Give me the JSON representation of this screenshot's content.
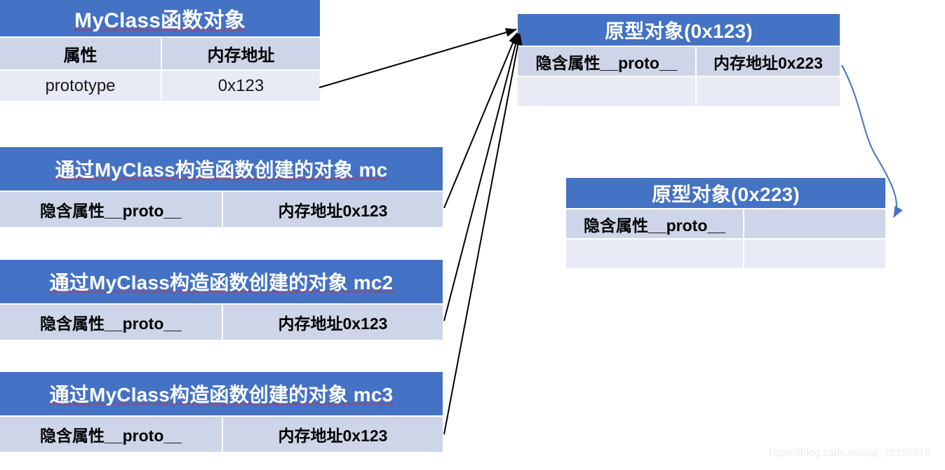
{
  "tables": {
    "myclass": {
      "title": "MyClass函数对象",
      "columns": [
        "属性",
        "内存地址"
      ],
      "rows": [
        [
          "prototype",
          "0x123"
        ]
      ]
    },
    "mc": {
      "title": "通过MyClass构造函数创建的对象 mc",
      "rows": [
        [
          "隐含属性__proto__",
          "内存地址0x123"
        ]
      ]
    },
    "mc2": {
      "title": "通过MyClass构造函数创建的对象 mc2",
      "rows": [
        [
          "隐含属性__proto__",
          "内存地址0x123"
        ]
      ]
    },
    "mc3": {
      "title": "通过MyClass构造函数创建的对象 mc3",
      "rows": [
        [
          "隐含属性__proto__",
          "内存地址0x123"
        ]
      ]
    },
    "proto1": {
      "title": "原型对象(0x123)",
      "rows": [
        [
          "隐含属性__proto__",
          "内存地址0x223"
        ],
        [
          "",
          ""
        ]
      ]
    },
    "proto2": {
      "title": "原型对象(0x223)",
      "rows": [
        [
          "隐含属性__proto__",
          ""
        ],
        [
          "",
          ""
        ]
      ]
    }
  },
  "watermark": "https://blog.csdn.net/qq_32755875",
  "colors": {
    "header_blue": "#4472C4",
    "row_dark": "#CFD5E8",
    "row_light": "#E8EBF5",
    "arrow_black": "#000000",
    "arrow_blue": "#4472C4"
  },
  "connectors": [
    {
      "name": "myclass-prototype-to-proto1",
      "from": "MyClass prototype 0x123",
      "to": "原型对象(0x123)",
      "color": "#000000"
    },
    {
      "name": "mc-proto-to-proto1",
      "from": "mc 隐含属性__proto__",
      "to": "原型对象(0x123)",
      "color": "#000000"
    },
    {
      "name": "mc2-proto-to-proto1",
      "from": "mc2 隐含属性__proto__",
      "to": "原型对象(0x123)",
      "color": "#000000"
    },
    {
      "name": "mc3-proto-to-proto1",
      "from": "mc3 隐含属性__proto__",
      "to": "原型对象(0x123)",
      "color": "#000000"
    },
    {
      "name": "proto1-to-proto2",
      "from": "原型对象(0x123) 内存地址0x223",
      "to": "原型对象(0x223)",
      "color": "#4472C4"
    }
  ]
}
